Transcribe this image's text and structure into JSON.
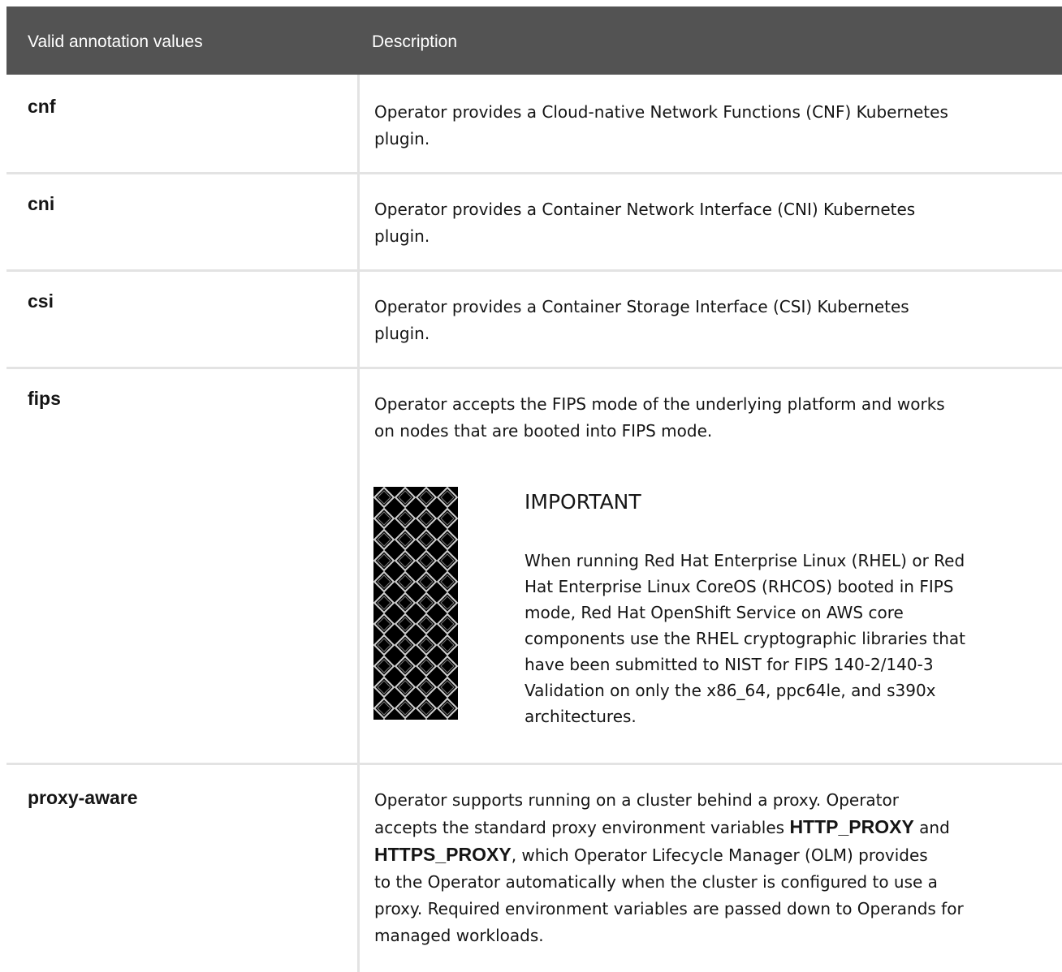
{
  "table": {
    "headers": [
      "Valid annotation values",
      "Description"
    ],
    "rows": [
      {
        "key": "cnf",
        "desc_lines": [
          "Operator provides a Cloud-native Network Functions (CNF) Kubernetes",
          "plugin."
        ]
      },
      {
        "key": "cni",
        "desc_lines": [
          "Operator provides a Container Network Interface (CNI) Kubernetes",
          "plugin."
        ]
      },
      {
        "key": "csi",
        "desc_lines": [
          "Operator provides a Container Storage Interface (CSI) Kubernetes",
          "plugin."
        ]
      },
      {
        "key": "fips",
        "desc_lines": [
          "Operator accepts the FIPS mode of the underlying platform and works",
          "on nodes that are booted into FIPS mode."
        ],
        "admonition": {
          "icon": "important-pattern-icon",
          "title": "IMPORTANT",
          "lines": [
            "When running Red Hat Enterprise Linux (RHEL) or Red",
            "Hat Enterprise Linux CoreOS (RHCOS) booted in FIPS",
            "mode, Red Hat OpenShift Service on AWS core",
            "components use the RHEL cryptographic libraries that",
            "have been submitted to NIST for FIPS 140-2/140-3",
            "Validation on only the x86_64, ppc64le, and s390x",
            "architectures."
          ]
        }
      },
      {
        "key": "proxy-aware",
        "desc_lines": [
          "Operator supports running on a cluster behind a proxy. Operator",
          [
            "accepts the standard proxy environment variables ",
            "HTTP_PROXY",
            " and"
          ],
          [
            "",
            "HTTPS_PROXY",
            ", which Operator Lifecycle Manager (OLM) provides"
          ],
          "to the Operator automatically when the cluster is configured to use a",
          "proxy. Required environment variables are passed down to Operands for",
          "managed workloads."
        ]
      }
    ]
  },
  "colors": {
    "header_bg": "#535353",
    "header_text": "#ffffff",
    "grid": "#e3e3e3",
    "text": "#151515"
  }
}
